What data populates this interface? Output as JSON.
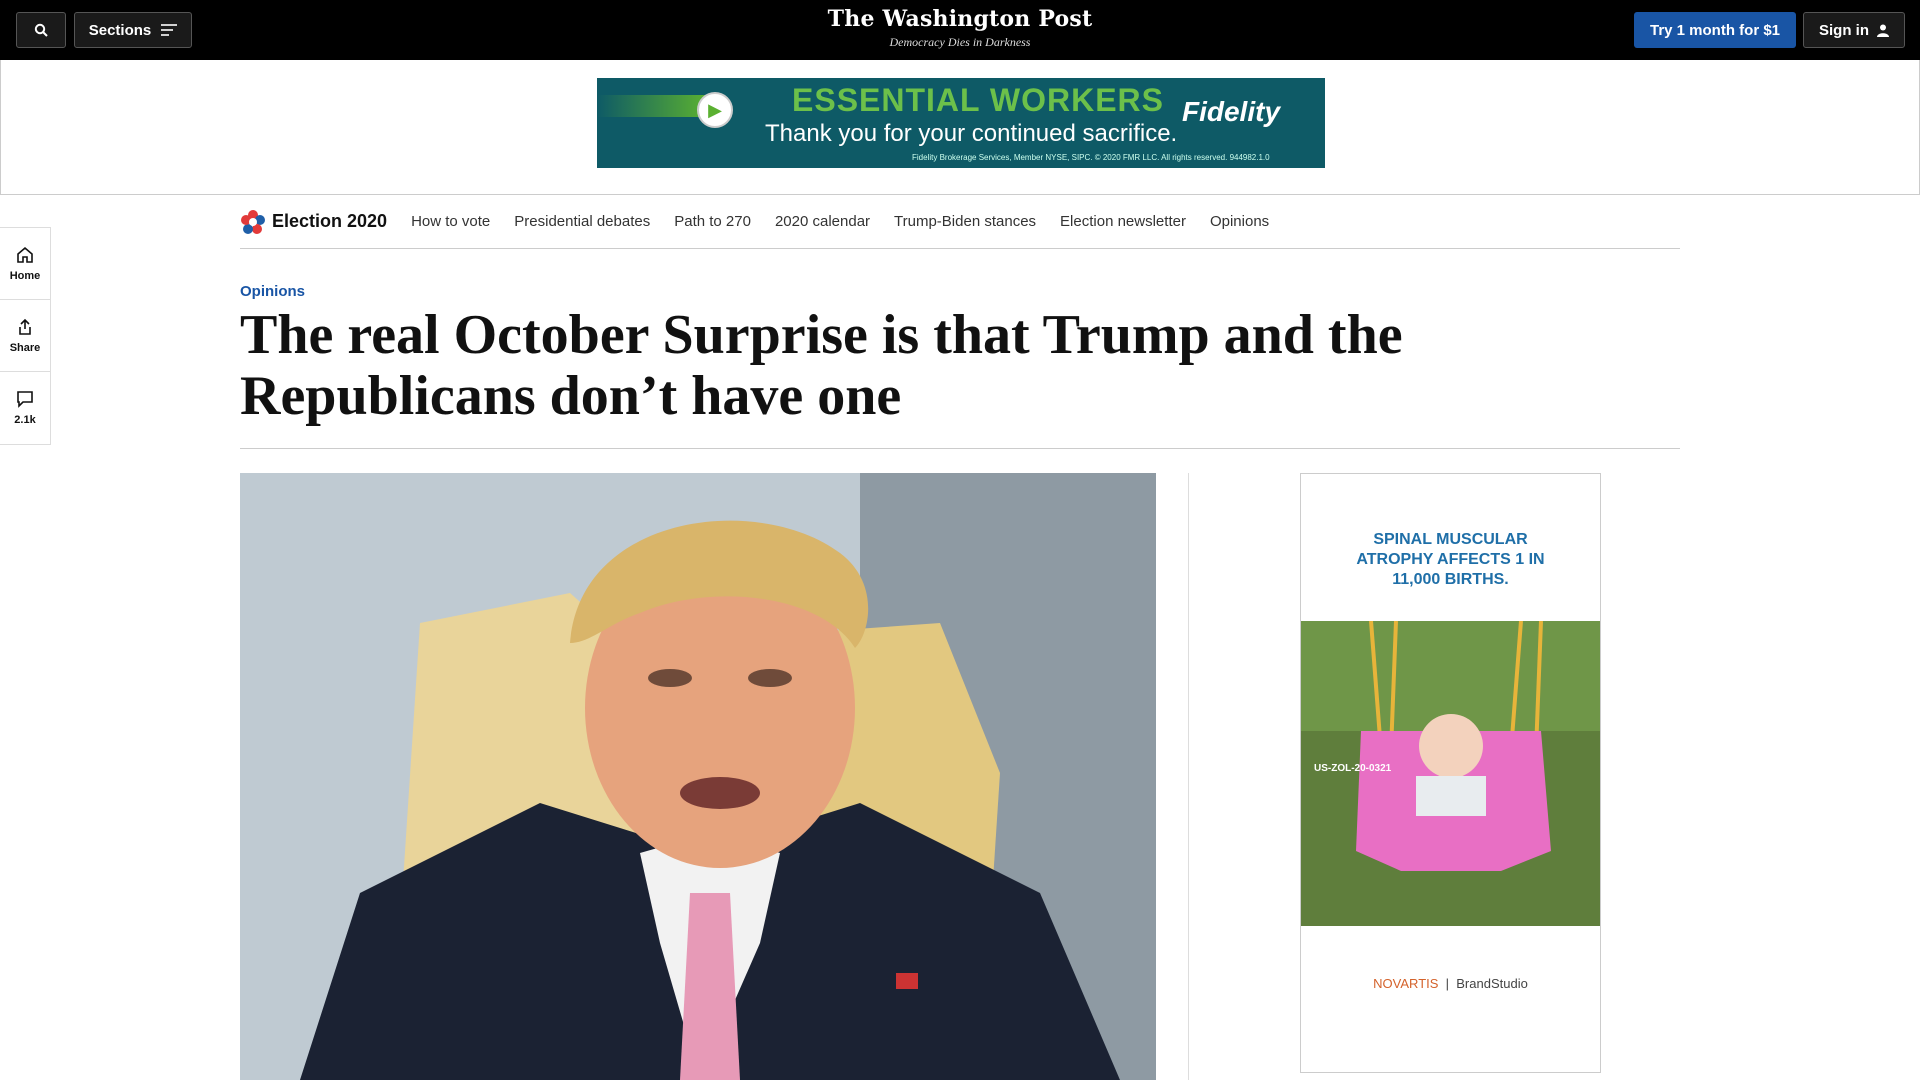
{
  "header": {
    "sections_label": "Sections",
    "logo_name": "The Washington Post",
    "logo_tagline": "Democracy Dies in Darkness",
    "try_label": "Try 1 month for $1",
    "signin_label": "Sign in"
  },
  "top_ad": {
    "headline": "ESSENTIAL WORKERS",
    "subline": "Thank you for your continued sacrifice.",
    "brand": "Fidelity",
    "fineprint": "Fidelity Brokerage Services, Member NYSE, SIPC. © 2020 FMR LLC. All rights reserved. 944982.1.0"
  },
  "rail": {
    "home_label": "Home",
    "share_label": "Share",
    "comments_count": "2.1k"
  },
  "election_nav": {
    "title": "Election 2020",
    "items": [
      "How to vote",
      "Presidential debates",
      "Path to 270",
      "2020 calendar",
      "Trump-Biden stances",
      "Election newsletter",
      "Opinions"
    ]
  },
  "article": {
    "kicker": "Opinions",
    "headline_line1": "The real October Surprise is that Trump and the",
    "headline_line2": "Republicans don’t have one"
  },
  "right_ad": {
    "headline_line1": "SPINAL MUSCULAR",
    "headline_line2": "ATROPHY AFFECTS 1 IN",
    "headline_line3": "11,000 BIRTHS.",
    "code": "US-ZOL-20-0321",
    "sponsor": "NOVARTIS",
    "studio": "BrandStudio"
  },
  "colors": {
    "accent_blue": "#1955a5",
    "topbar": "#000000"
  }
}
